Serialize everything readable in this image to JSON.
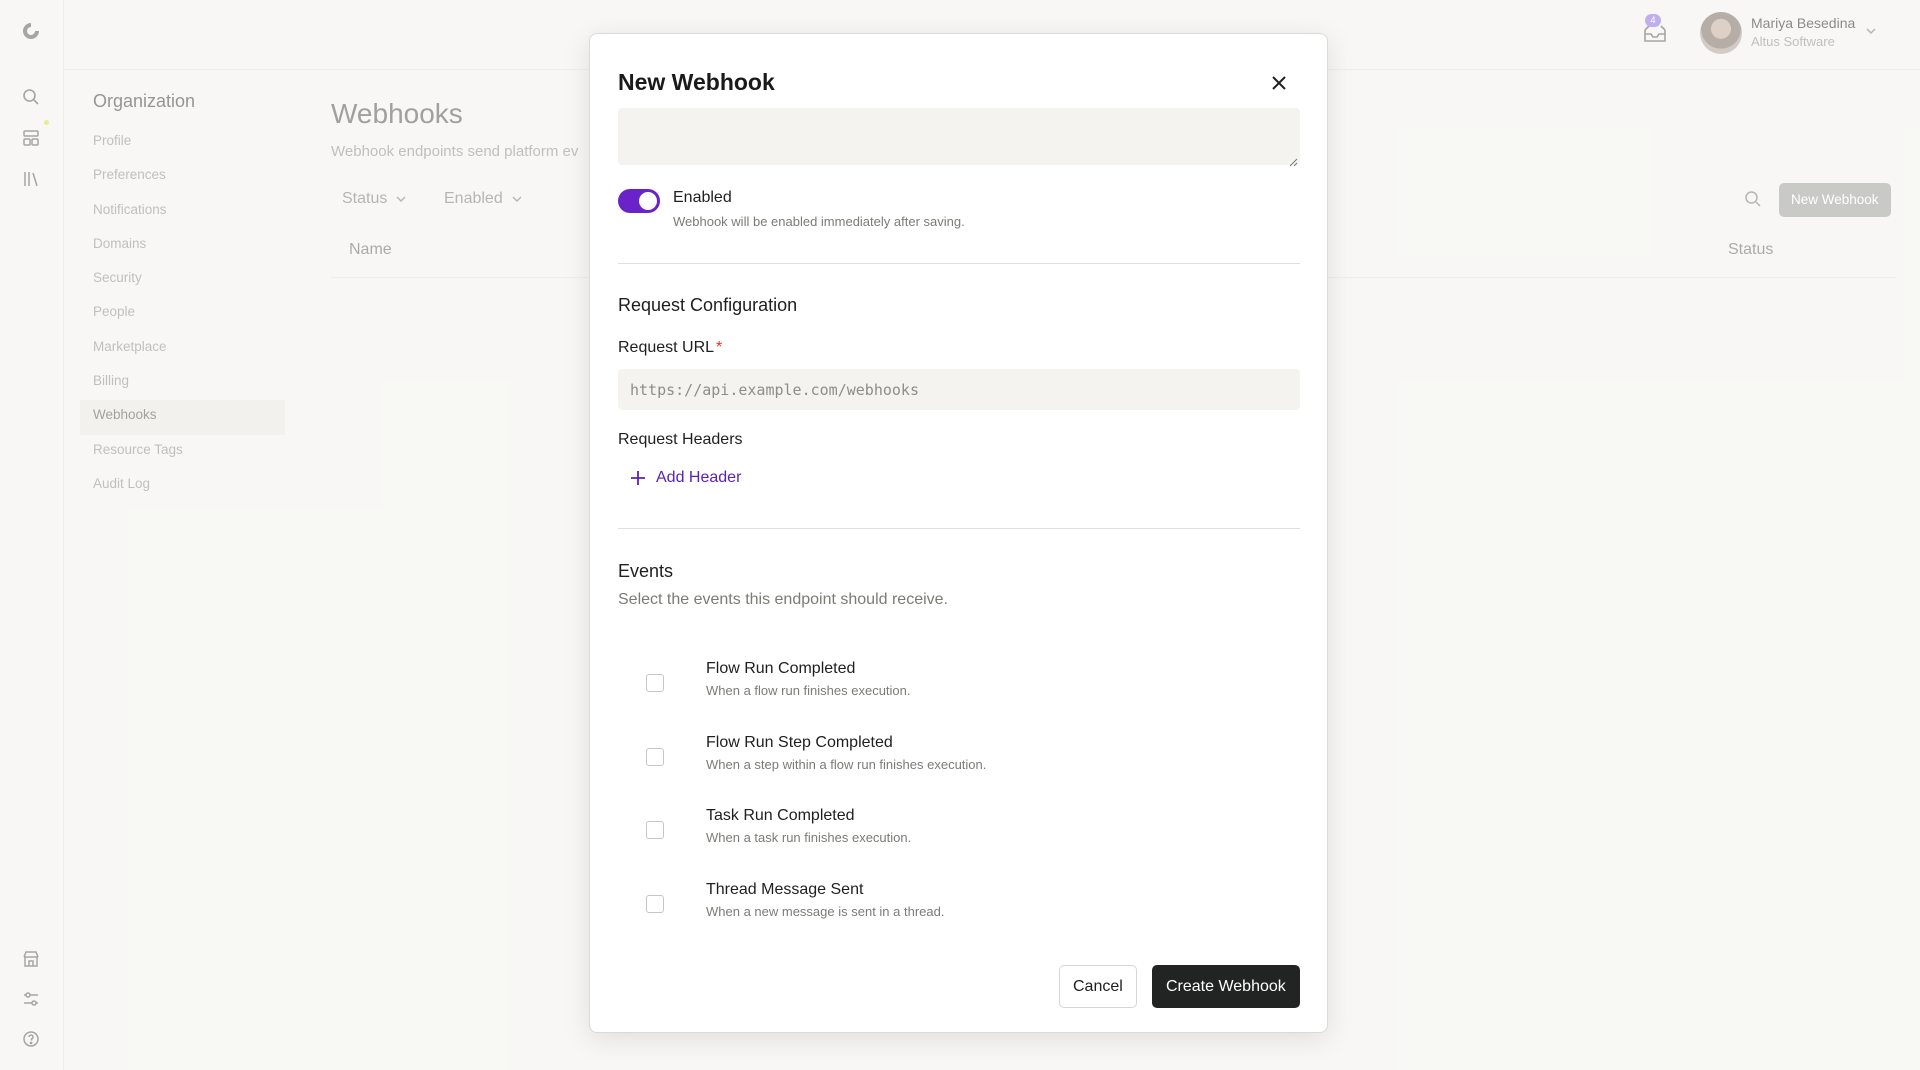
{
  "colors": {
    "accent": "#6a22c9",
    "primary_button": "#222423",
    "required": "#d9342b"
  },
  "topbar": {
    "notification_count": "4",
    "user_name": "Mariya Besedina",
    "user_org": "Altus Software"
  },
  "sidebar": {
    "title": "Organization",
    "items": [
      {
        "label": "Profile"
      },
      {
        "label": "Preferences"
      },
      {
        "label": "Notifications"
      },
      {
        "label": "Domains"
      },
      {
        "label": "Security"
      },
      {
        "label": "People"
      },
      {
        "label": "Marketplace"
      },
      {
        "label": "Billing"
      },
      {
        "label": "Webhooks",
        "active": true
      },
      {
        "label": "Resource Tags"
      },
      {
        "label": "Audit Log"
      }
    ]
  },
  "page": {
    "title": "Webhooks",
    "subtitle": "Webhook endpoints send platform ev",
    "filters": {
      "status": "Status",
      "enabled": "Enabled"
    },
    "new_button": "New Webhook",
    "columns": {
      "name": "Name",
      "status": "Status"
    }
  },
  "modal": {
    "title": "New Webhook",
    "enabled": {
      "label": "Enabled",
      "help": "Webhook will be enabled immediately after saving.",
      "on": true
    },
    "request_config": {
      "title": "Request Configuration",
      "url_label": "Request URL",
      "url_required": "*",
      "url_placeholder": "https://api.example.com/webhooks",
      "headers_label": "Request Headers",
      "add_header": "Add Header"
    },
    "events": {
      "title": "Events",
      "subtitle": "Select the events this endpoint should receive.",
      "items": [
        {
          "name": "Flow Run Completed",
          "desc": "When a flow run finishes execution.",
          "checked": false
        },
        {
          "name": "Flow Run Step Completed",
          "desc": "When a step within a flow run finishes execution.",
          "checked": false
        },
        {
          "name": "Task Run Completed",
          "desc": "When a task run finishes execution.",
          "checked": false
        },
        {
          "name": "Thread Message Sent",
          "desc": "When a new message is sent in a thread.",
          "checked": false
        }
      ]
    },
    "cancel": "Cancel",
    "submit": "Create Webhook"
  }
}
